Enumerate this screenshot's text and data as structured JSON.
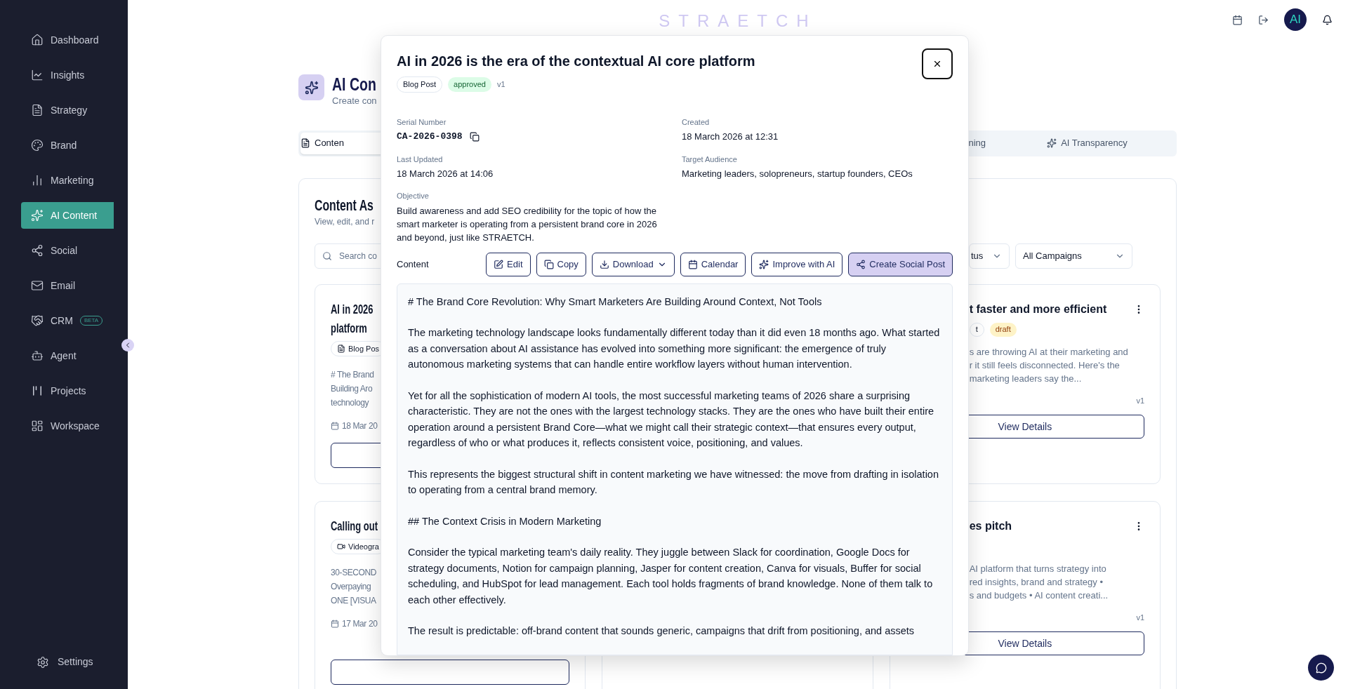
{
  "sidebar": {
    "items": [
      {
        "label": "Dashboard",
        "selected": false
      },
      {
        "label": "Insights",
        "selected": false
      },
      {
        "label": "Strategy",
        "selected": false
      },
      {
        "label": "Brand",
        "selected": false
      },
      {
        "label": "Marketing",
        "selected": false
      },
      {
        "label": "AI Content",
        "selected": true
      },
      {
        "label": "Social",
        "selected": false
      },
      {
        "label": "Email",
        "selected": false
      },
      {
        "label": "CRM",
        "selected": false,
        "badge": "BETA"
      },
      {
        "label": "Agent",
        "selected": false
      },
      {
        "label": "Projects",
        "selected": false
      },
      {
        "label": "Workspace",
        "selected": false
      }
    ],
    "footer": {
      "label": "Settings"
    }
  },
  "header": {
    "logo": "STRAETCH",
    "avatar": "AI"
  },
  "page": {
    "title": "AI Con",
    "subtitle": "Create con"
  },
  "tabs": [
    {
      "label": "Conten",
      "selected": true
    },
    {
      "label": "ning",
      "selected": false
    },
    {
      "label": "AI Transparency",
      "selected": false
    }
  ],
  "panel": {
    "title": "Content As",
    "subtitle": "View, edit, and r",
    "search": {
      "placeholder": "Search co"
    },
    "filters": [
      {
        "label": "tus"
      },
      {
        "label": "All Campaigns"
      }
    ]
  },
  "cards_left": [
    {
      "title_lines": [
        "AI in 2026",
        "platform"
      ],
      "badge": {
        "label": "Blog Pos",
        "kind": "document"
      },
      "excerpt_lines": [
        "# The Brand",
        "Building Aro",
        "technology"
      ],
      "date": "18 Mar 20"
    },
    {
      "title_lines": [
        "Calling out"
      ],
      "badge": {
        "label": "Videogra",
        "kind": "video"
      },
      "excerpt_lines": [
        "30-SECOND",
        "Overpaying",
        "ONE [VISUA"
      ],
      "date": "17 Mar 20"
    }
  ],
  "cards_right": [
    {
      "title": "t faster and more efficient",
      "badges": [
        {
          "label": "t",
          "kind": "type"
        },
        {
          "label": "draft",
          "kind": "draft"
        }
      ],
      "excerpt_lines": [
        "s are throwing AI at their marketing and",
        "r it still feels disconnected. Here's the",
        "marketing leaders say the..."
      ],
      "version": "v1",
      "button": "View Details"
    },
    {
      "title": "es pitch",
      "excerpt_lines": [
        "AI platform that turns strategy into",
        "red insights, brand and strategy •",
        "s and budgets • AI content creati..."
      ],
      "version": "v1",
      "button": "View Details"
    }
  ],
  "modal": {
    "title": "AI in 2026 is the era of the contextual AI core platform",
    "badges": [
      {
        "label": "Blog Post",
        "kind": "type"
      },
      {
        "label": "approved",
        "kind": "approved"
      }
    ],
    "version": "v1",
    "fields": [
      {
        "label": "Serial Number",
        "value": "CA-2026-0398",
        "kind": "serial"
      },
      {
        "label": "Created",
        "value": "18 March 2026 at 12:31",
        "kind": "text"
      },
      {
        "label": "Last Updated",
        "value": "18 March 2026 at 14:06",
        "kind": "text"
      },
      {
        "label": "Target Audience",
        "value": "Marketing leaders, solopreneurs, startup founders, CEOs",
        "kind": "text"
      },
      {
        "label": "Objective",
        "value": "Build awareness and add SEO credibility for the topic of how the smart marketer is operating from a persistent brand core in 2026 and beyond, just like STRAETCH.",
        "kind": "text"
      }
    ],
    "content_label": "Content",
    "actions": [
      {
        "label": "Edit",
        "kind": "edit",
        "primary": false
      },
      {
        "label": "Copy",
        "kind": "copy",
        "primary": false
      },
      {
        "label": "Download",
        "kind": "download",
        "primary": false
      },
      {
        "label": "Calendar",
        "kind": "calendar",
        "primary": false
      },
      {
        "label": "Improve with AI",
        "kind": "improve",
        "primary": false
      },
      {
        "label": "Create Social Post",
        "kind": "share",
        "primary": true
      }
    ],
    "content": [
      "# The Brand Core Revolution: Why Smart Marketers Are Building Around Context, Not Tools",
      "The marketing technology landscape looks fundamentally different today than it did even 18 months ago. What started as a conversation about AI assistance has evolved into something more significant: the emergence of truly autonomous marketing systems that can handle entire workflow layers without human intervention.",
      "Yet for all the sophistication of modern AI tools, the most successful marketing teams of 2026 share a surprising characteristic. They are not the ones with the largest technology stacks. They are the ones who have built their entire operation around a persistent Brand Core—what we might call their strategic context—that ensures every output, regardless of who or what produces it, reflects consistent voice, positioning, and values.",
      "This represents the biggest structural shift in content marketing we have witnessed: the move from drafting in isolation to operating from a central brand memory.",
      "## The Context Crisis in Modern Marketing",
      "Consider the typical marketing team's daily reality. They juggle between Slack for coordination, Google Docs for strategy documents, Notion for campaign planning, Jasper for content creation, Canva for visuals, Buffer for social scheduling, and HubSpot for lead management. Each tool holds fragments of brand knowledge. None of them talk to each other effectively.",
      "The result is predictable: off-brand content that sounds generic, campaigns that drift from positioning, and assets"
    ]
  }
}
